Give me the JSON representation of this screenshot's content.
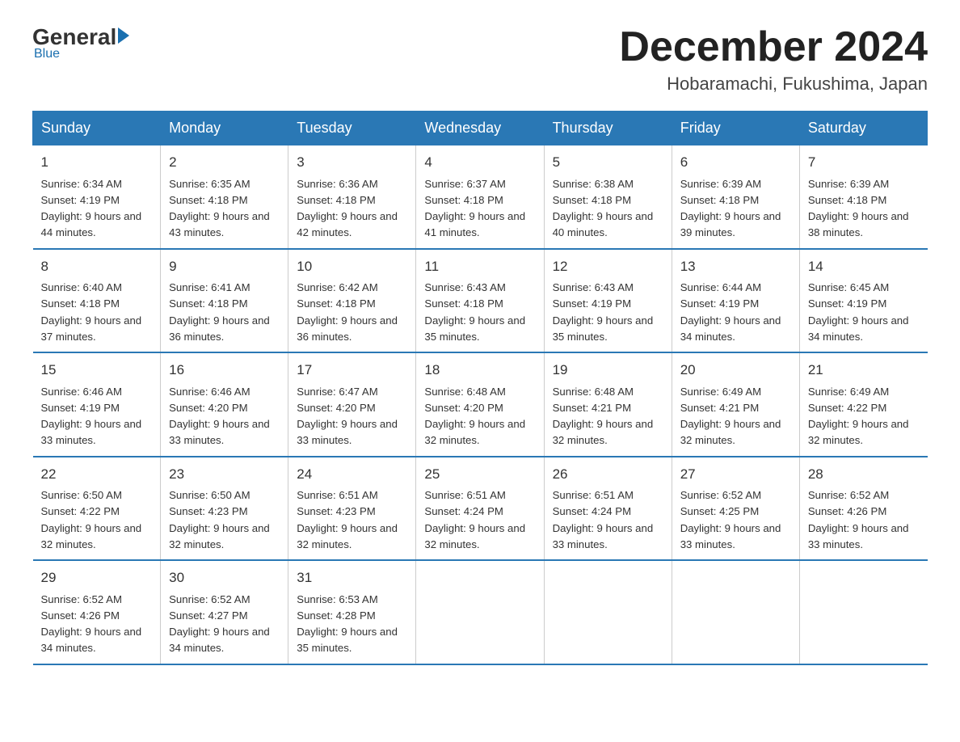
{
  "logo": {
    "general": "General",
    "arrow": "",
    "blue": "Blue",
    "subtitle": "Blue"
  },
  "title": "December 2024",
  "location": "Hobaramachi, Fukushima, Japan",
  "weekdays": [
    "Sunday",
    "Monday",
    "Tuesday",
    "Wednesday",
    "Thursday",
    "Friday",
    "Saturday"
  ],
  "weeks": [
    [
      {
        "day": "1",
        "sunrise": "6:34 AM",
        "sunset": "4:19 PM",
        "daylight": "9 hours and 44 minutes."
      },
      {
        "day": "2",
        "sunrise": "6:35 AM",
        "sunset": "4:18 PM",
        "daylight": "9 hours and 43 minutes."
      },
      {
        "day": "3",
        "sunrise": "6:36 AM",
        "sunset": "4:18 PM",
        "daylight": "9 hours and 42 minutes."
      },
      {
        "day": "4",
        "sunrise": "6:37 AM",
        "sunset": "4:18 PM",
        "daylight": "9 hours and 41 minutes."
      },
      {
        "day": "5",
        "sunrise": "6:38 AM",
        "sunset": "4:18 PM",
        "daylight": "9 hours and 40 minutes."
      },
      {
        "day": "6",
        "sunrise": "6:39 AM",
        "sunset": "4:18 PM",
        "daylight": "9 hours and 39 minutes."
      },
      {
        "day": "7",
        "sunrise": "6:39 AM",
        "sunset": "4:18 PM",
        "daylight": "9 hours and 38 minutes."
      }
    ],
    [
      {
        "day": "8",
        "sunrise": "6:40 AM",
        "sunset": "4:18 PM",
        "daylight": "9 hours and 37 minutes."
      },
      {
        "day": "9",
        "sunrise": "6:41 AM",
        "sunset": "4:18 PM",
        "daylight": "9 hours and 36 minutes."
      },
      {
        "day": "10",
        "sunrise": "6:42 AM",
        "sunset": "4:18 PM",
        "daylight": "9 hours and 36 minutes."
      },
      {
        "day": "11",
        "sunrise": "6:43 AM",
        "sunset": "4:18 PM",
        "daylight": "9 hours and 35 minutes."
      },
      {
        "day": "12",
        "sunrise": "6:43 AM",
        "sunset": "4:19 PM",
        "daylight": "9 hours and 35 minutes."
      },
      {
        "day": "13",
        "sunrise": "6:44 AM",
        "sunset": "4:19 PM",
        "daylight": "9 hours and 34 minutes."
      },
      {
        "day": "14",
        "sunrise": "6:45 AM",
        "sunset": "4:19 PM",
        "daylight": "9 hours and 34 minutes."
      }
    ],
    [
      {
        "day": "15",
        "sunrise": "6:46 AM",
        "sunset": "4:19 PM",
        "daylight": "9 hours and 33 minutes."
      },
      {
        "day": "16",
        "sunrise": "6:46 AM",
        "sunset": "4:20 PM",
        "daylight": "9 hours and 33 minutes."
      },
      {
        "day": "17",
        "sunrise": "6:47 AM",
        "sunset": "4:20 PM",
        "daylight": "9 hours and 33 minutes."
      },
      {
        "day": "18",
        "sunrise": "6:48 AM",
        "sunset": "4:20 PM",
        "daylight": "9 hours and 32 minutes."
      },
      {
        "day": "19",
        "sunrise": "6:48 AM",
        "sunset": "4:21 PM",
        "daylight": "9 hours and 32 minutes."
      },
      {
        "day": "20",
        "sunrise": "6:49 AM",
        "sunset": "4:21 PM",
        "daylight": "9 hours and 32 minutes."
      },
      {
        "day": "21",
        "sunrise": "6:49 AM",
        "sunset": "4:22 PM",
        "daylight": "9 hours and 32 minutes."
      }
    ],
    [
      {
        "day": "22",
        "sunrise": "6:50 AM",
        "sunset": "4:22 PM",
        "daylight": "9 hours and 32 minutes."
      },
      {
        "day": "23",
        "sunrise": "6:50 AM",
        "sunset": "4:23 PM",
        "daylight": "9 hours and 32 minutes."
      },
      {
        "day": "24",
        "sunrise": "6:51 AM",
        "sunset": "4:23 PM",
        "daylight": "9 hours and 32 minutes."
      },
      {
        "day": "25",
        "sunrise": "6:51 AM",
        "sunset": "4:24 PM",
        "daylight": "9 hours and 32 minutes."
      },
      {
        "day": "26",
        "sunrise": "6:51 AM",
        "sunset": "4:24 PM",
        "daylight": "9 hours and 33 minutes."
      },
      {
        "day": "27",
        "sunrise": "6:52 AM",
        "sunset": "4:25 PM",
        "daylight": "9 hours and 33 minutes."
      },
      {
        "day": "28",
        "sunrise": "6:52 AM",
        "sunset": "4:26 PM",
        "daylight": "9 hours and 33 minutes."
      }
    ],
    [
      {
        "day": "29",
        "sunrise": "6:52 AM",
        "sunset": "4:26 PM",
        "daylight": "9 hours and 34 minutes."
      },
      {
        "day": "30",
        "sunrise": "6:52 AM",
        "sunset": "4:27 PM",
        "daylight": "9 hours and 34 minutes."
      },
      {
        "day": "31",
        "sunrise": "6:53 AM",
        "sunset": "4:28 PM",
        "daylight": "9 hours and 35 minutes."
      },
      null,
      null,
      null,
      null
    ]
  ]
}
